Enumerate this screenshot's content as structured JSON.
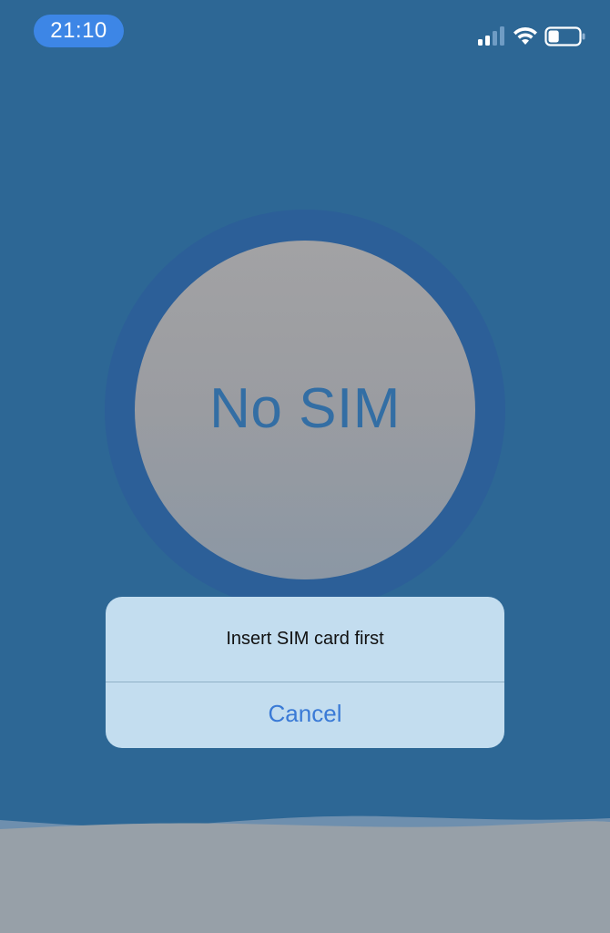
{
  "status_bar": {
    "time": "21:10",
    "icons": [
      "signal-icon",
      "wifi-icon",
      "battery-icon"
    ],
    "battery_level": 0.35
  },
  "main": {
    "circle_label": "No SIM"
  },
  "dialog": {
    "message": "Insert SIM card first",
    "cancel_label": "Cancel"
  },
  "colors": {
    "background": "#2d6795",
    "accent": "#3a7ad6",
    "dialog_bg": "#c3ddef",
    "time_pill": "#3d86e6"
  }
}
